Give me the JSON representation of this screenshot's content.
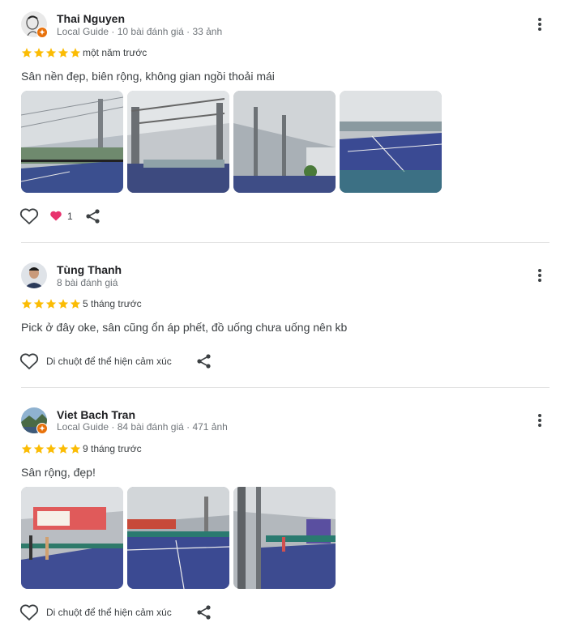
{
  "reviews": [
    {
      "author": "Thai Nguyen",
      "meta": "Local Guide · 10 bài đánh giá · 33 ảnh",
      "rating": 5,
      "time": "một năm trước",
      "text": "Sân nền đẹp, biên rộng, không gian ngồi thoải mái",
      "photo_count": 4,
      "reaction_count": "1"
    },
    {
      "author": "Tùng Thanh",
      "meta": "8 bài đánh giá",
      "rating": 5,
      "time": "5 tháng trước",
      "text": "Pick ở đây oke, sân cũng ổn áp phết, đồ uống chưa uống nên kb",
      "photo_count": 0,
      "reaction_hint": "Di chuột để thể hiện cảm xúc"
    },
    {
      "author": "Viet Bach Tran",
      "meta": "Local Guide · 84 bài đánh giá · 471 ảnh",
      "rating": 5,
      "time": "9 tháng trước",
      "text": "Sân rộng, đẹp!",
      "photo_count": 3,
      "reaction_hint": "Di chuột để thể hiện cảm xúc"
    }
  ],
  "colors": {
    "star": "#fbbc04",
    "heart_filled": "#e8336e",
    "guide_badge": "#e8710a",
    "divider": "#e0e0e0"
  }
}
